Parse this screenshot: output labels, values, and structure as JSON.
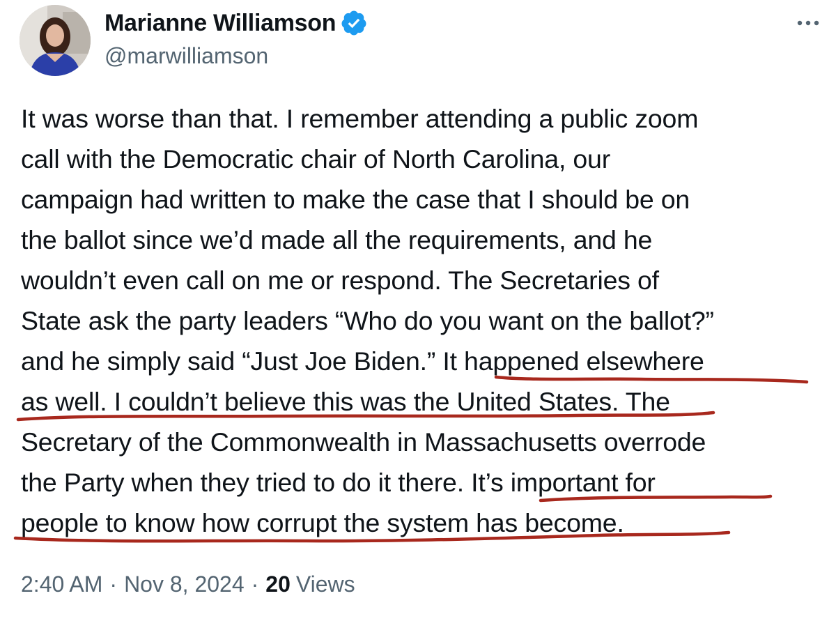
{
  "author": {
    "display_name": "Marianne Williamson",
    "handle": "@marwilliamson",
    "verified_icon": "verified-badge-icon",
    "verified_color": "#1d9bf0"
  },
  "more_icon": "more-horizontal-icon",
  "tweet": {
    "lines": [
      "It was worse than that. I remember attending a public zoom",
      "call with the Democratic chair of North Carolina, our",
      "campaign had written to make the case that I should be on",
      "the ballot since we’d made all the requirements, and he",
      "wouldn’t even call on me or respond. The Secretaries of",
      "State ask the party leaders “Who do you want on the ballot?”",
      "and he simply said “Just Joe Biden.” It happened elsewhere",
      "as well. I couldn’t believe this was the United States. The",
      "Secretary of the Commonwealth in Massachusetts overrode",
      "the Party when they tried to do it there. It’s important for",
      "people to know how corrupt the system has become."
    ],
    "underline_color": "#a8281d"
  },
  "meta": {
    "time": "2:40 AM",
    "date": "Nov 8, 2024",
    "separator": "·",
    "views_count": "20",
    "views_label": "Views"
  },
  "colors": {
    "text": "#0f1419",
    "secondary": "#536471",
    "background": "#ffffff"
  }
}
